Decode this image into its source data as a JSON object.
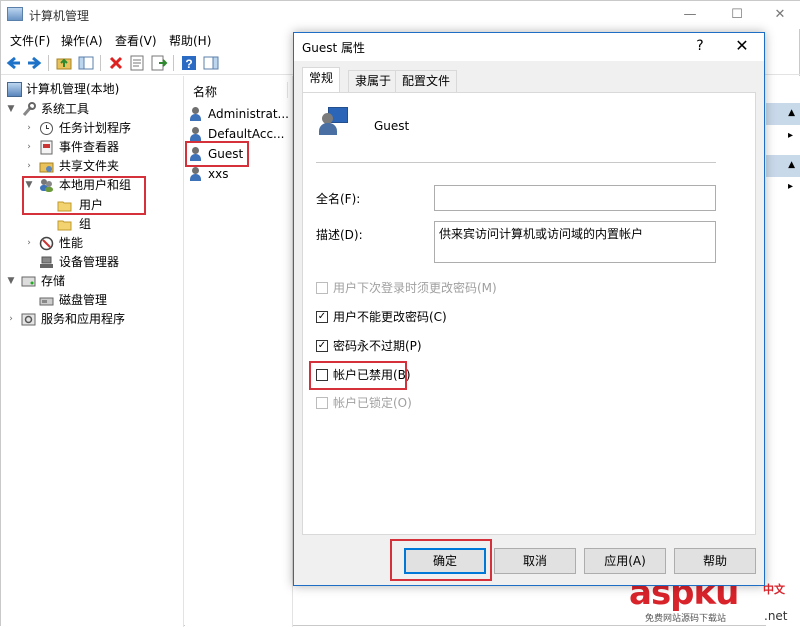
{
  "app": {
    "title": "计算机管理"
  },
  "window_controls": {
    "minimize": "—",
    "maximize": "☐",
    "close": "✕"
  },
  "menu": [
    "文件(F)",
    "操作(A)",
    "查看(V)",
    "帮助(H)"
  ],
  "tree": [
    {
      "label": "计算机管理(本地)",
      "icon": "computer-management-icon",
      "arrow": ""
    },
    {
      "label": "系统工具",
      "icon": "tools-icon",
      "arrow": "▼"
    },
    {
      "label": "任务计划程序",
      "icon": "clock-icon",
      "arrow": "›"
    },
    {
      "label": "事件查看器",
      "icon": "event-viewer-icon",
      "arrow": "›"
    },
    {
      "label": "共享文件夹",
      "icon": "shared-folder-icon",
      "arrow": "›"
    },
    {
      "label": "本地用户和组",
      "icon": "users-groups-icon",
      "arrow": "▼"
    },
    {
      "label": "用户",
      "icon": "folder-icon",
      "arrow": ""
    },
    {
      "label": "组",
      "icon": "folder-icon",
      "arrow": ""
    },
    {
      "label": "性能",
      "icon": "performance-icon",
      "arrow": "›"
    },
    {
      "label": "设备管理器",
      "icon": "device-manager-icon",
      "arrow": ""
    },
    {
      "label": "存储",
      "icon": "storage-icon",
      "arrow": "▼"
    },
    {
      "label": "磁盘管理",
      "icon": "disk-icon",
      "arrow": ""
    },
    {
      "label": "服务和应用程序",
      "icon": "services-icon",
      "arrow": "›"
    }
  ],
  "list": {
    "header": "名称",
    "users": [
      "Administrat...",
      "DefaultAcc...",
      "Guest",
      "xxs"
    ]
  },
  "dialog": {
    "title": "Guest 属性",
    "help": "?",
    "close": "✕",
    "tabs": [
      "常规",
      "隶属于",
      "配置文件"
    ],
    "username": "Guest",
    "fullname_label": "全名(F):",
    "fullname_value": "",
    "description_label": "描述(D):",
    "description_value": "供来宾访问计算机或访问域的内置帐户",
    "checkboxes": [
      {
        "label": "用户下次登录时须更改密码(M)",
        "checked": false,
        "disabled": true
      },
      {
        "label": "用户不能更改密码(C)",
        "checked": true,
        "disabled": false
      },
      {
        "label": "密码永不过期(P)",
        "checked": true,
        "disabled": false
      },
      {
        "label": "帐户已禁用(B)",
        "checked": false,
        "disabled": false
      },
      {
        "label": "帐户已锁定(O)",
        "checked": false,
        "disabled": true
      }
    ],
    "buttons": {
      "ok": "确定",
      "cancel": "取消",
      "apply": "应用(A)",
      "help": "帮助"
    }
  },
  "watermark": {
    "brand": "aspku",
    "cn": "中文",
    "sub": "免费网站源码下载站",
    "net": ".net"
  },
  "colors": {
    "highlight": "#d4313b",
    "accent": "#0078d7",
    "action_bar": "#c8d9ea"
  }
}
